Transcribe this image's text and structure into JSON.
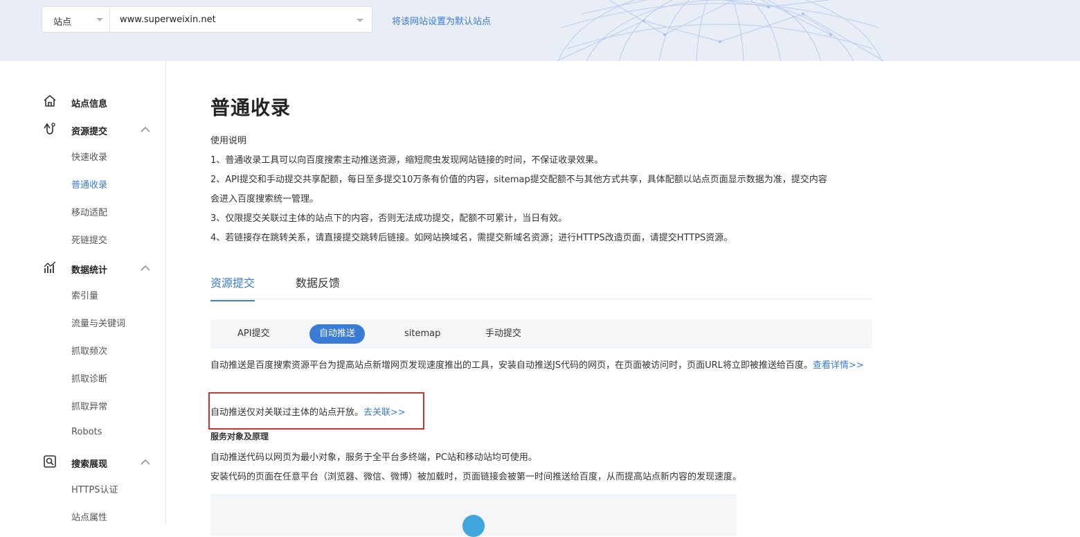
{
  "header": {
    "site_type_label": "站点",
    "site_url": "www.superweixin.net",
    "set_default_link": "将该网站设置为默认站点"
  },
  "sidebar": {
    "groups": [
      {
        "label": "站点信息",
        "icon": "home-icon"
      },
      {
        "label": "资源提交",
        "icon": "submit-icon",
        "items": [
          "快速收录",
          "普通收录",
          "移动适配",
          "死链提交"
        ]
      },
      {
        "label": "数据统计",
        "icon": "stats-icon",
        "items": [
          "索引量",
          "流量与关键词",
          "抓取频次",
          "抓取诊断",
          "抓取异常",
          "Robots"
        ]
      },
      {
        "label": "搜索展现",
        "icon": "search-display-icon",
        "items": [
          "HTTPS认证",
          "站点属性"
        ]
      }
    ],
    "active_item": "普通收录"
  },
  "main": {
    "title": "普通收录",
    "instructions": [
      "使用说明",
      "1、普通收录工具可以向百度搜索主动推送资源，缩短爬虫发现网站链接的时间，不保证收录效果。",
      "2、API提交和手动提交共享配额，每日至多提交10万条有价值的内容，sitemap提交配额不与其他方式共享，具体配额以站点页面显示数据为准，提交内容",
      "会进入百度搜索统一管理。",
      "3、仅限提交关联过主体的站点下的内容，否则无法成功提交，配额不可累计，当日有效。",
      "4、若链接存在跳转关系，请直接提交跳转后链接。如网站换域名，需提交新域名资源；进行HTTPS改造页面，请提交HTTPS资源。"
    ],
    "tabs": [
      {
        "label": "资源提交",
        "active": true
      },
      {
        "label": "数据反馈",
        "active": false
      }
    ],
    "subtabs": [
      {
        "label": "API提交",
        "active": false
      },
      {
        "label": "自动推送",
        "active": true
      },
      {
        "label": "sitemap",
        "active": false
      },
      {
        "label": "手动提交",
        "active": false
      }
    ],
    "auto_push_desc": "自动推送是百度搜索资源平台为提高站点新增网页发现速度推出的工具，安装自动推送JS代码的网页，在页面被访问时，页面URL将立即被推送给百度。",
    "view_details_link": "查看详情>>",
    "notice_text": "自动推送仅对关联过主体的站点开放。",
    "notice_link": "去关联>>",
    "section_title": "服务对象及原理",
    "section_lines": [
      "自动推送代码以网页为最小对象，服务于全平台多终端，PC站和移动站均可使用。",
      "安装代码的页面在任意平台（浏览器、微信、微博）被加载时，页面链接会被第一时间推送给百度，从而提高站点新内容的发现速度。"
    ]
  },
  "colors": {
    "accent": "#3a7bd5",
    "notice_border": "#d72f2f",
    "header_bg": "#e9edf6"
  }
}
